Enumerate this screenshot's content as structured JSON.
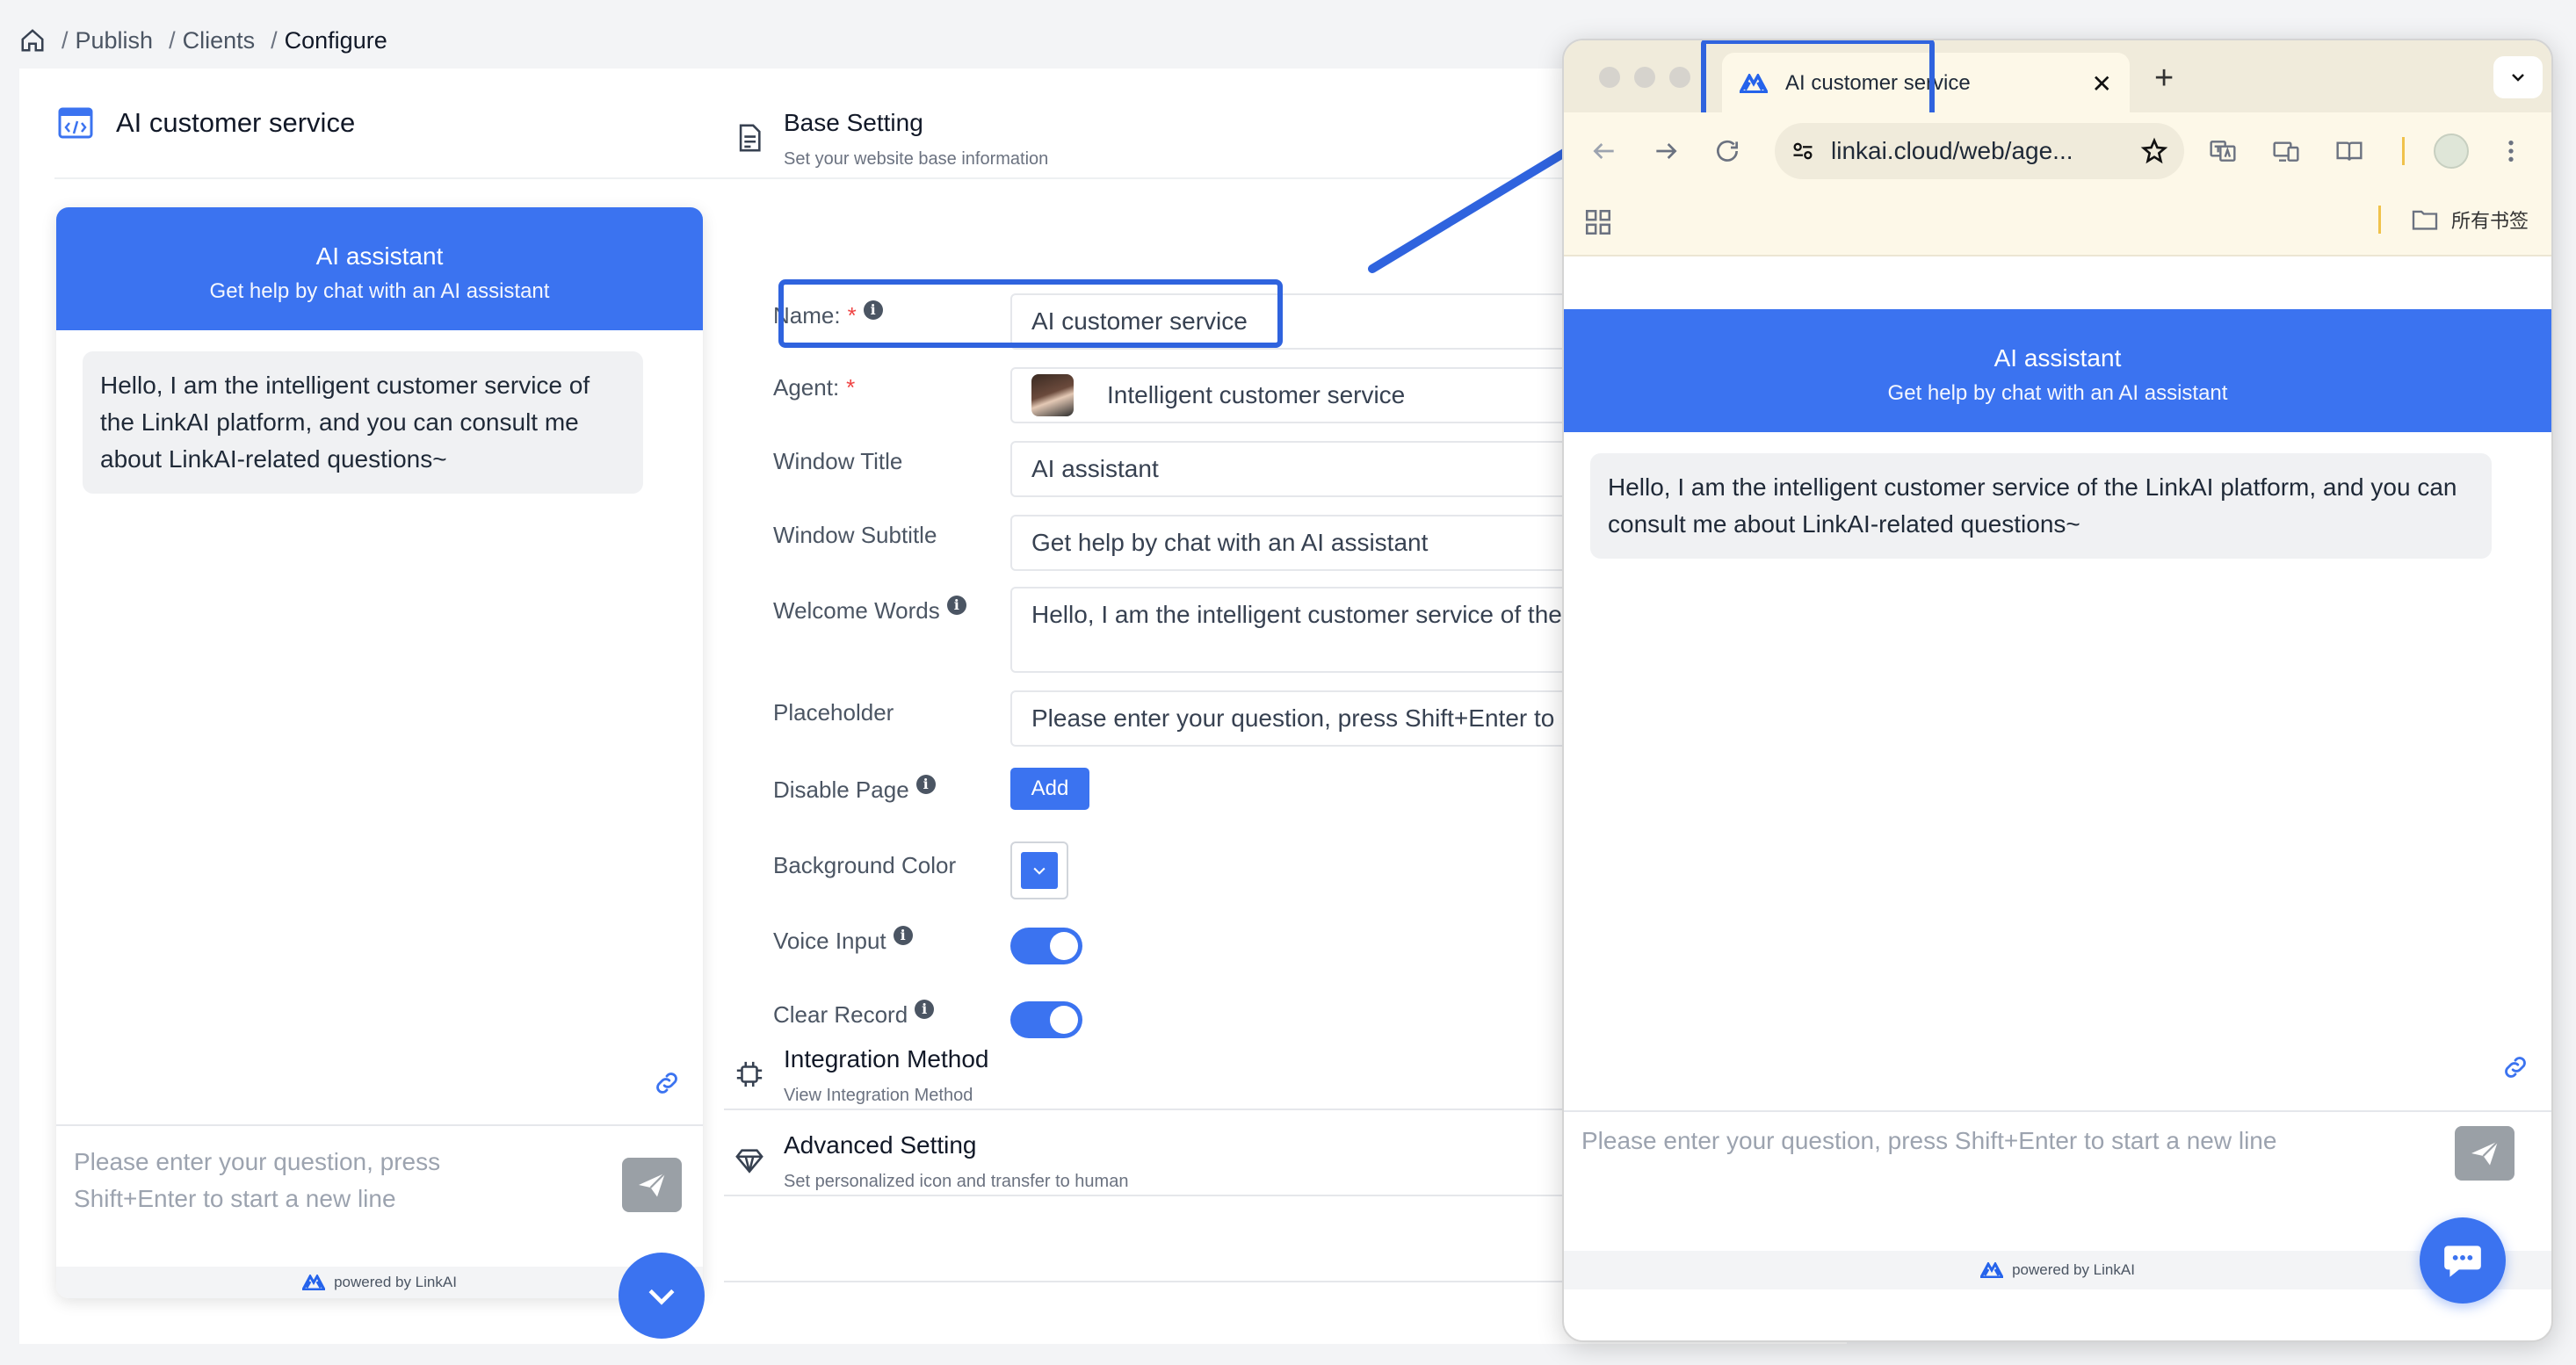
{
  "breadcrumb": {
    "items": [
      {
        "label": "Publish"
      },
      {
        "label": "Clients"
      },
      {
        "label": "Configure"
      }
    ]
  },
  "page": {
    "title": "AI customer service"
  },
  "preview": {
    "title": "AI assistant",
    "subtitle": "Get help by chat with an AI assistant",
    "welcome": "Hello, I am the intelligent customer service of the LinkAI platform, and you can consult me about LinkAI-related questions~",
    "placeholder": "Please enter your question, press Shift+Enter to start a new line",
    "powered": "powered by LinkAI"
  },
  "base_setting": {
    "title": "Base Setting",
    "subtitle": "Set your website base information",
    "fields": {
      "name": {
        "label": "Name:",
        "required": "*",
        "value": "AI customer service"
      },
      "agent": {
        "label": "Agent:",
        "required": "*",
        "value": "Intelligent customer service"
      },
      "window_title": {
        "label": "Window Title",
        "value": "AI assistant"
      },
      "window_subtitle": {
        "label": "Window Subtitle",
        "value": "Get help by chat with an AI assistant"
      },
      "welcome_words": {
        "label": "Welcome Words",
        "value": "Hello, I am the intelligent customer service of the LinkAI platform, and you can consult me about LinkAI-related questions~"
      },
      "placeholder": {
        "label": "Placeholder",
        "value": "Please enter your question, press Shift+Enter to start a new line"
      },
      "disable_page": {
        "label": "Disable Page",
        "button": "Add"
      },
      "background_color": {
        "label": "Background Color",
        "value": "#3b73f0"
      },
      "voice_input": {
        "label": "Voice Input",
        "on": true
      },
      "clear_record": {
        "label": "Clear Record",
        "on": true
      }
    }
  },
  "integration": {
    "title": "Integration Method",
    "subtitle": "View Integration Method"
  },
  "advanced": {
    "title": "Advanced Setting",
    "subtitle": "Set personalized icon and transfer to human"
  },
  "browser": {
    "tab_title": "AI customer service",
    "url": "linkai.cloud/web/age...",
    "bookmarks_label": "所有书签",
    "chat": {
      "title": "AI assistant",
      "subtitle": "Get help by chat with an AI assistant",
      "welcome": "Hello, I am the intelligent customer service of the LinkAI platform, and you can consult me about LinkAI-related questions~",
      "placeholder": "Please enter your question, press Shift+Enter to start a new line",
      "powered": "powered by LinkAI"
    }
  },
  "colors": {
    "accent": "#3b73f0",
    "highlight": "#2f63de"
  }
}
